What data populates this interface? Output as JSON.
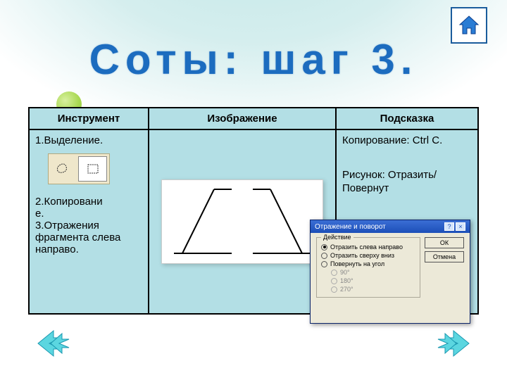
{
  "title": "Соты: шаг 3.",
  "table": {
    "headers": [
      "Инструмент",
      "Изображение",
      "Подсказка"
    ],
    "col1": {
      "item1": "1.Выделение.",
      "item2": "2.Копировани\nе.",
      "item3": "3.Отражения фрагмента слева направо."
    },
    "col3": {
      "hint1": "Копирование: Ctrl C.",
      "hint2": "Рисунок: Отразить/Повернут"
    }
  },
  "dialog": {
    "title": "Отражение и поворот",
    "legend": "Действие",
    "opt1": "Отразить слева направо",
    "opt2": "Отразить сверху вниз",
    "opt3": "Повернуть на угол",
    "ang1": "90°",
    "ang2": "180°",
    "ang3": "270°",
    "ok": "ОК",
    "cancel": "Отмена"
  },
  "icons": {
    "home": "home-icon",
    "prev": "prev-arrow",
    "next": "next-arrow"
  }
}
